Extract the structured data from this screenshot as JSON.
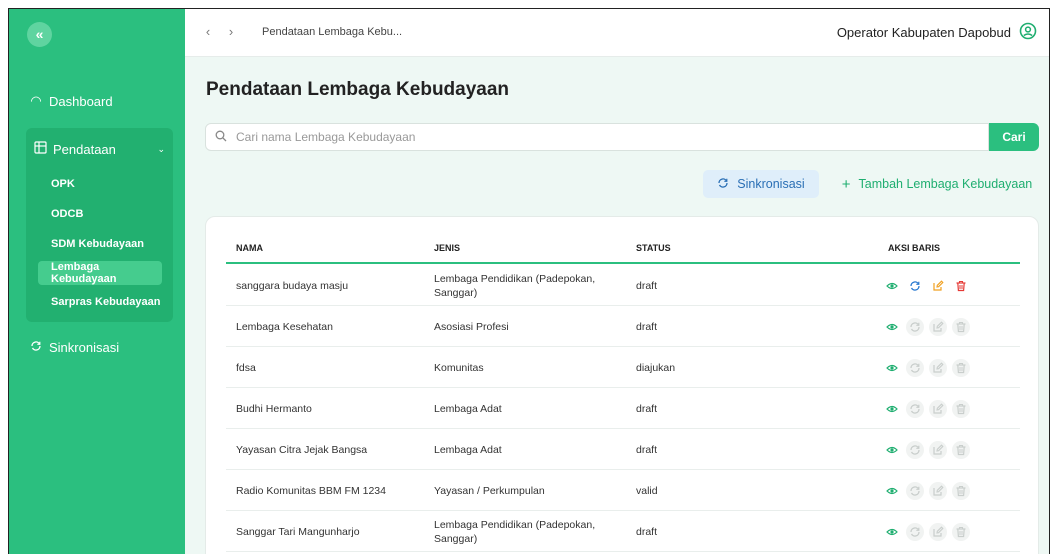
{
  "topbar": {
    "breadcrumb": "Pendataan Lembaga Kebu...",
    "user": "Operator Kabupaten Dapobud"
  },
  "sidebar": {
    "collapse_glyph": "«",
    "dashboard": "Dashboard",
    "pendataan": "Pendataan",
    "sub_items": [
      {
        "label": "OPK",
        "active": false
      },
      {
        "label": "ODCB",
        "active": false
      },
      {
        "label": "SDM Kebudayaan",
        "active": false
      },
      {
        "label": "Lembaga Kebudayaan",
        "active": true
      },
      {
        "label": "Sarpras Kebudayaan",
        "active": false
      }
    ],
    "sinkronisasi": "Sinkronisasi"
  },
  "main": {
    "title": "Pendataan Lembaga Kebudayaan",
    "search_placeholder": "Cari nama Lembaga Kebudayaan",
    "search_button": "Cari",
    "sync_button": "Sinkronisasi",
    "add_button": "Tambah Lembaga Kebudayaan"
  },
  "table": {
    "headers": [
      "NAMA",
      "JENIS",
      "STATUS",
      "AKSI BARIS"
    ],
    "rows": [
      {
        "nama": "sanggara budaya masju",
        "jenis": "Lembaga Pendidikan (Padepokan, Sanggar)",
        "status": "draft",
        "actions_enabled": true
      },
      {
        "nama": "Lembaga Kesehatan",
        "jenis": "Asosiasi Profesi",
        "status": "draft",
        "actions_enabled": false
      },
      {
        "nama": "fdsa",
        "jenis": "Komunitas",
        "status": "diajukan",
        "actions_enabled": false
      },
      {
        "nama": "Budhi Hermanto",
        "jenis": "Lembaga Adat",
        "status": "draft",
        "actions_enabled": false
      },
      {
        "nama": "Yayasan Citra Jejak Bangsa",
        "jenis": "Lembaga Adat",
        "status": "draft",
        "actions_enabled": false
      },
      {
        "nama": "Radio Komunitas BBM FM 1234",
        "jenis": "Yayasan / Perkumpulan",
        "status": "valid",
        "actions_enabled": false
      },
      {
        "nama": "Sanggar Tari Mangunharjo",
        "jenis": "Lembaga Pendidikan (Padepokan, Sanggar)",
        "status": "draft",
        "actions_enabled": false
      }
    ],
    "action_icons": [
      "eye-icon",
      "sync-icon",
      "edit-icon",
      "trash-icon"
    ]
  },
  "colors": {
    "brand": "#2bbf7f",
    "eye": "#1fae70",
    "sync": "#2a7ad0",
    "edit": "#f0a020",
    "trash": "#e53935",
    "disabled": "#c9cecc"
  }
}
